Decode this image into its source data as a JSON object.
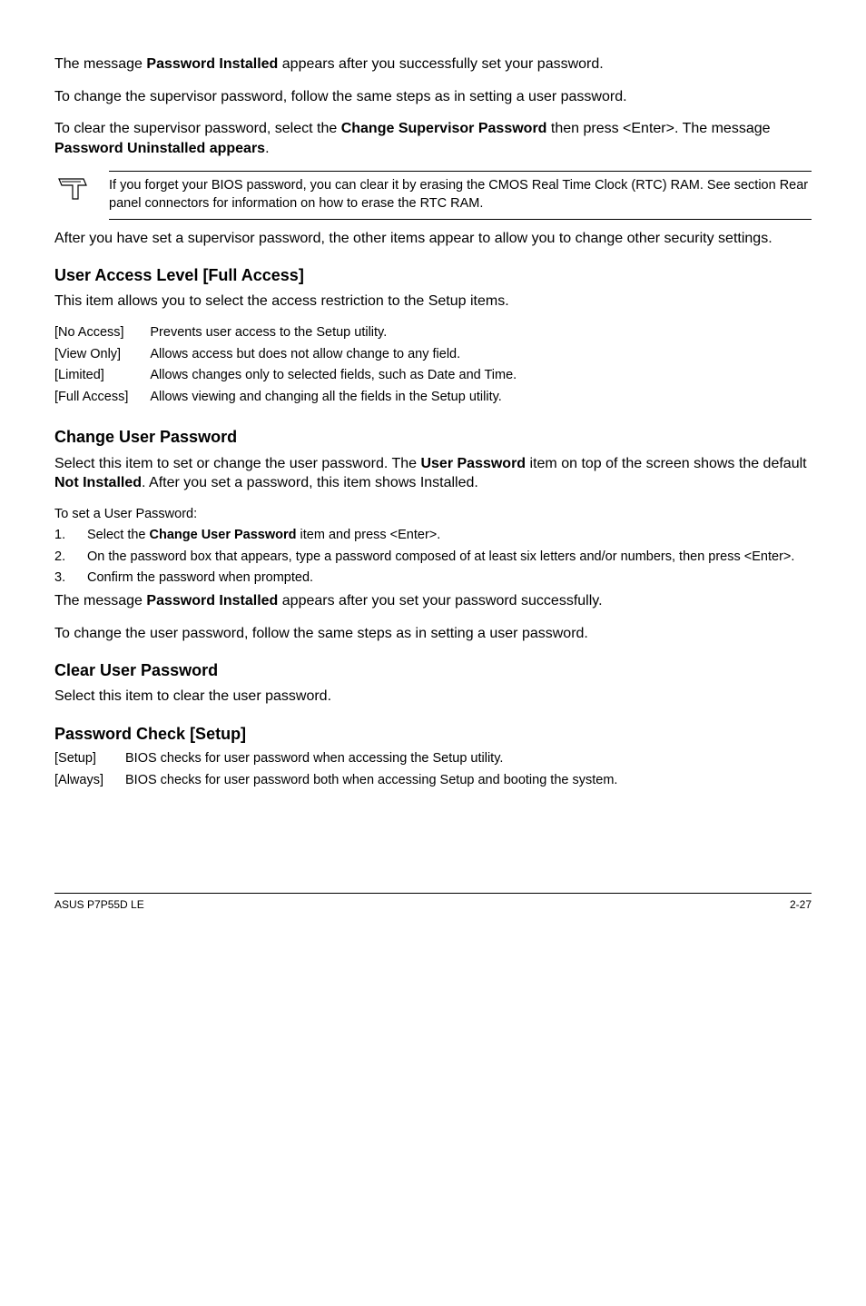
{
  "para1_a": "The message ",
  "para1_b": "Password Installed",
  "para1_c": " appears after you successfully set your password.",
  "para2": "To change the supervisor password, follow the same steps as in setting a user password.",
  "para3_a": "To clear the supervisor password, select the ",
  "para3_b": "Change Supervisor Password",
  "para3_c": " then press <Enter>. The message ",
  "para3_d": "Password Uninstalled appears",
  "para3_e": ".",
  "note": "If you forget your BIOS password, you can clear it by erasing the CMOS Real Time Clock (RTC) RAM. See section Rear panel connectors for information on how to erase the RTC RAM.",
  "para4": "After you have set a supervisor password, the other items appear to allow you to change other security settings.",
  "h_ual": "User Access Level [Full Access]",
  "ual_intro": "This item allows you to select the access restriction to the Setup items.",
  "ual": {
    "r1t": "[No Access]",
    "r1d": "Prevents user access to the Setup utility.",
    "r2t": "[View Only]",
    "r2d": "Allows access but does not allow change to any field.",
    "r3t": "[Limited]",
    "r3d": "Allows changes only to selected fields, such as Date and Time.",
    "r4t": "[Full Access]",
    "r4d": "Allows viewing and changing all the fields in the Setup utility."
  },
  "h_cup": "Change User Password",
  "cup_a": "Select this item to set or change the user password. The ",
  "cup_b": "User Password",
  "cup_c": " item on top of the screen shows the default ",
  "cup_d": "Not Installed",
  "cup_e": ". After you set a password, this item shows Installed.",
  "toset": "To set a User Password:",
  "li1_a": "Select the ",
  "li1_b": "Change User Password",
  "li1_c": " item and press <Enter>.",
  "li2": "On the password box that appears, type a password composed of at least six letters and/or numbers, then press <Enter>.",
  "li3": "Confirm the password when prompted.",
  "afterlist_a": "The message ",
  "afterlist_b": "Password Installed",
  "afterlist_c": " appears after you set your password successfully.",
  "tochange": "To change the user password, follow the same steps as in setting a user password.",
  "h_clearup": "Clear User Password",
  "clearup_body": "Select this item to clear the user password.",
  "h_pwcheck": "Password Check [Setup]",
  "pwc": {
    "r1t": "[Setup]",
    "r1d": "BIOS checks for user password when accessing the Setup utility.",
    "r2t": "[Always]",
    "r2d": "BIOS checks for user password both when accessing Setup and booting the system."
  },
  "footer_left": "ASUS P7P55D LE",
  "footer_right": "2-27"
}
